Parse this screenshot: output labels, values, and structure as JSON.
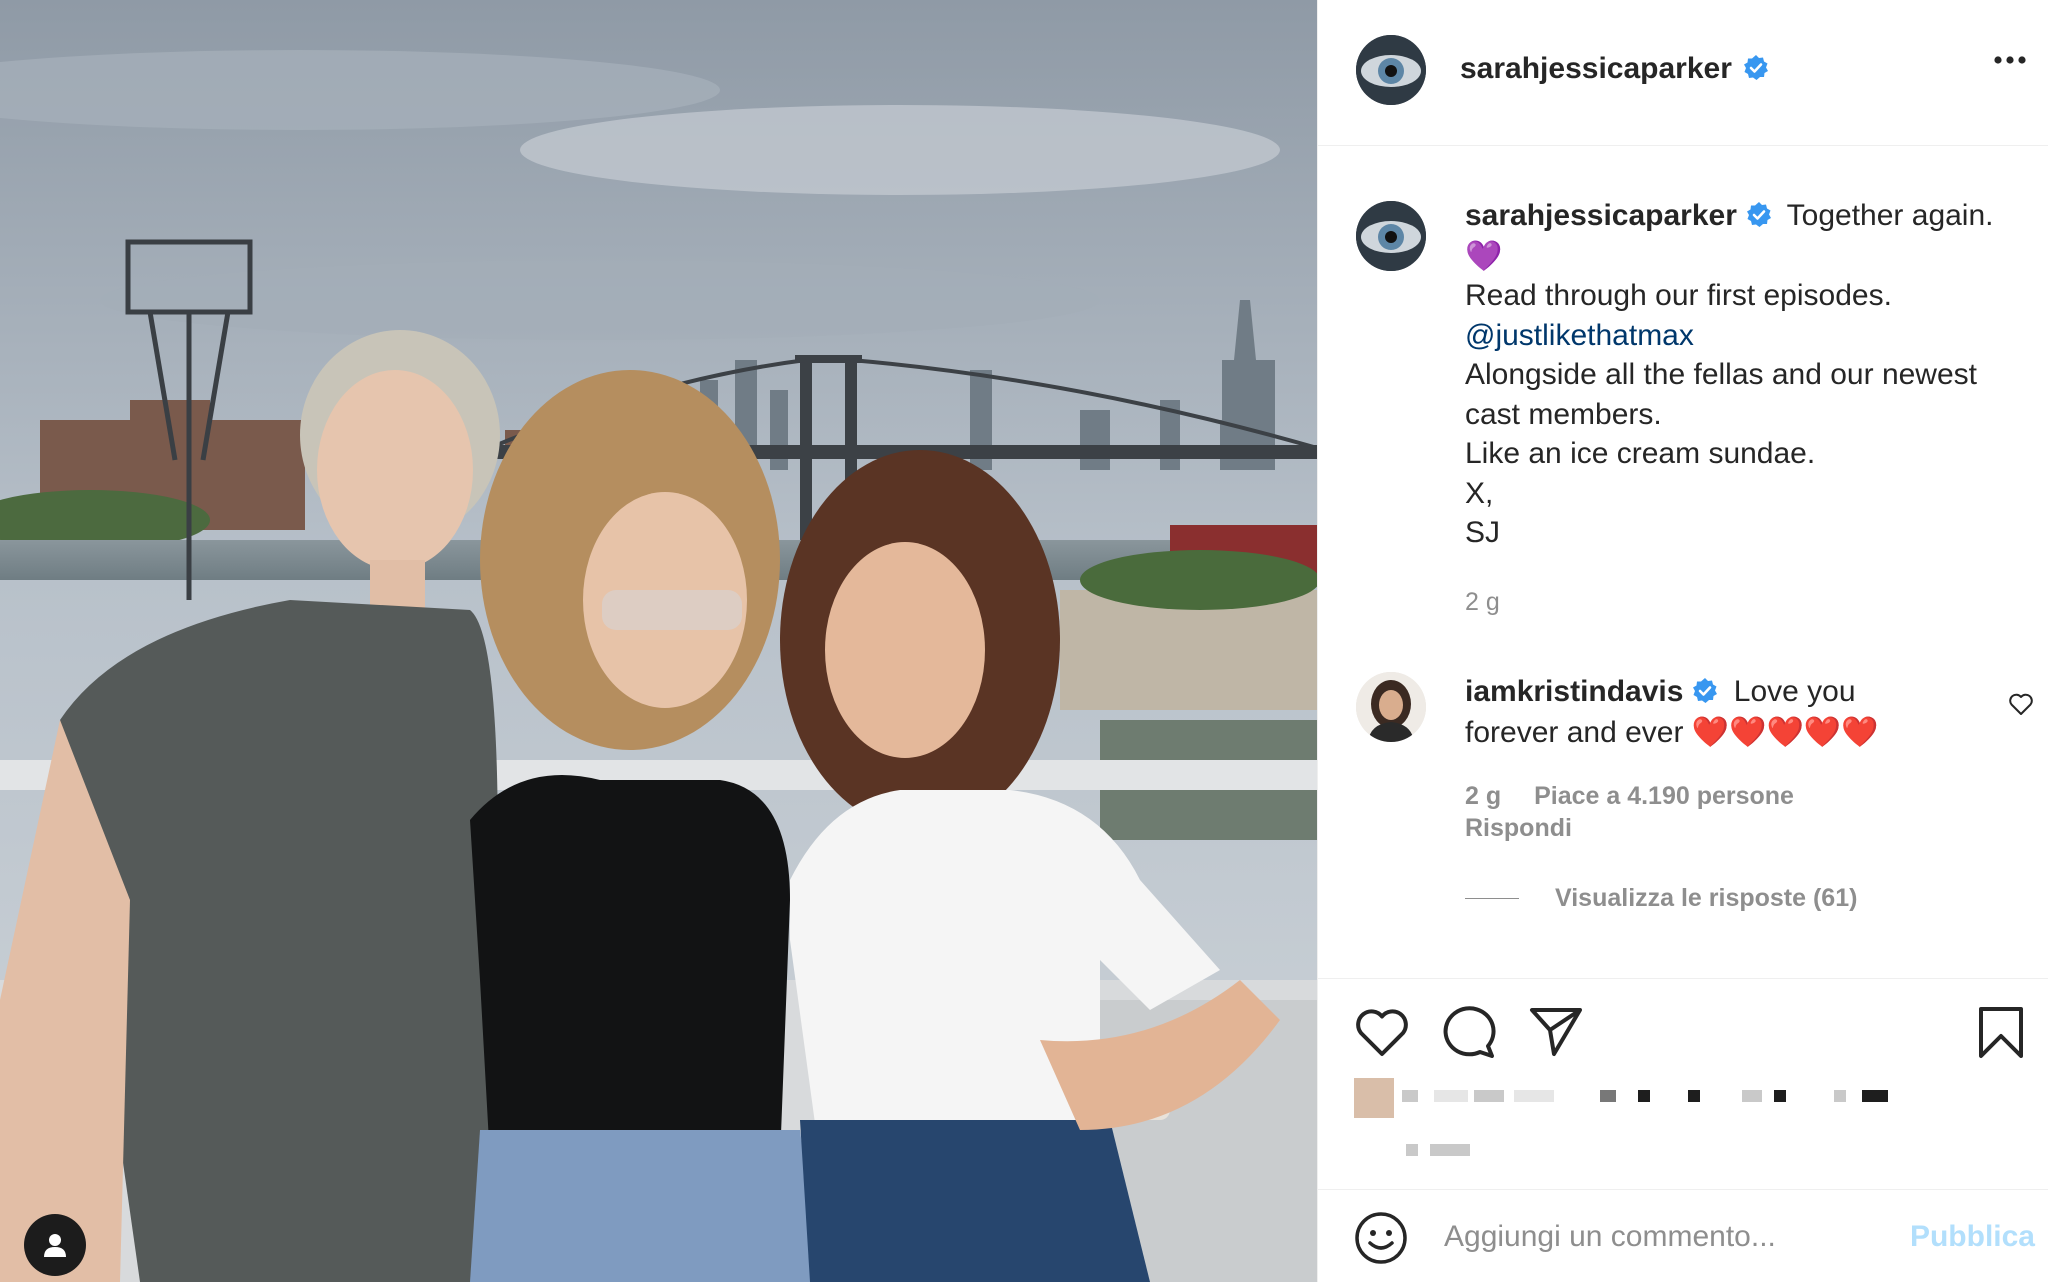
{
  "post": {
    "author": "sarahjessicaparker",
    "caption": {
      "first_line": "Together again.",
      "emoji": "💜",
      "line2": "Read through our first episodes.",
      "mention": "@justlikethatmax",
      "line4": "Alongside all the fellas and our newest cast members.",
      "line5": "Like an ice cream sundae.",
      "line6": "X,",
      "line7": "SJ"
    },
    "time_ago": "2 g"
  },
  "comment": {
    "author": "iamkristindavis",
    "text_start": "Love you",
    "text_end": "forever and ever",
    "hearts": "❤️❤️❤️❤️❤️",
    "time_ago": "2 g",
    "likes": "Piace a 4.190 persone",
    "reply": "Rispondi",
    "view_replies": "Visualizza le risposte (61)"
  },
  "comment_bar": {
    "placeholder": "Aggiungi un commento...",
    "publish": "Pubblica"
  },
  "icons": {
    "verified": "verified-badge-icon",
    "more": "more-options-icon",
    "like": "heart-icon",
    "comment": "comment-bubble-icon",
    "share": "paper-plane-icon",
    "save": "bookmark-icon",
    "emoji": "smiley-icon",
    "tag": "user-tag-icon"
  },
  "colors": {
    "verified": "#3897f0",
    "mention": "#00376b",
    "meta": "#8e8e8e",
    "publish_disabled": "#b2dffc"
  }
}
